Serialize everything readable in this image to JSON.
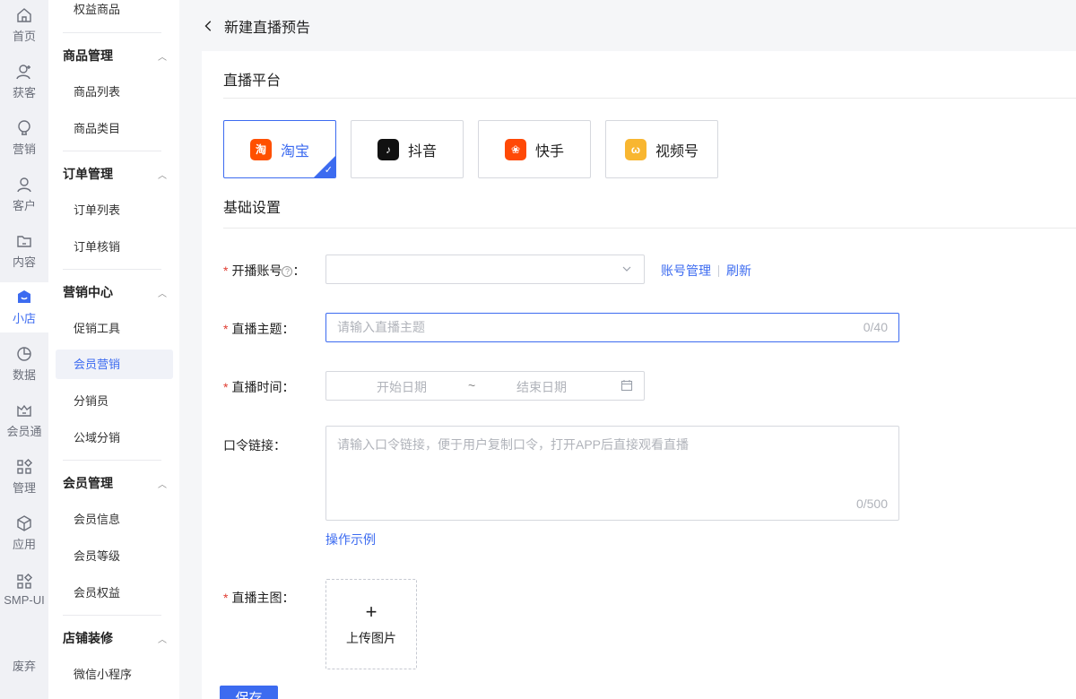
{
  "rail": {
    "items": [
      {
        "label": "首页"
      },
      {
        "label": "获客"
      },
      {
        "label": "营销"
      },
      {
        "label": "客户"
      },
      {
        "label": "内容"
      },
      {
        "label": "小店"
      },
      {
        "label": "数据"
      },
      {
        "label": "会员通"
      },
      {
        "label": "管理"
      },
      {
        "label": "应用"
      },
      {
        "label": "SMP-UI"
      }
    ],
    "bottom_label": "废弃"
  },
  "submenu": {
    "top_item": "权益商品",
    "groups": [
      {
        "title": "商品管理",
        "items": [
          "商品列表",
          "商品类目"
        ]
      },
      {
        "title": "订单管理",
        "items": [
          "订单列表",
          "订单核销"
        ]
      },
      {
        "title": "营销中心",
        "items": [
          "促销工具",
          "会员营销",
          "分销员",
          "公域分销"
        ]
      },
      {
        "title": "会员管理",
        "items": [
          "会员信息",
          "会员等级",
          "会员权益"
        ]
      },
      {
        "title": "店铺装修",
        "items": [
          "微信小程序"
        ]
      }
    ]
  },
  "header": {
    "title": "新建直播预告"
  },
  "platform_section": {
    "title": "直播平台",
    "platforms": [
      {
        "label": "淘宝",
        "icon": "taobao-icon",
        "color": "#ff5000"
      },
      {
        "label": "抖音",
        "icon": "douyin-icon",
        "color": "#111111"
      },
      {
        "label": "快手",
        "icon": "kuaishou-icon",
        "color": "#ff4906"
      },
      {
        "label": "视频号",
        "icon": "channels-icon",
        "color": "#f8b631"
      }
    ]
  },
  "basic_section": {
    "title": "基础设置",
    "account": {
      "label": "开播账号",
      "colon": "：",
      "links": {
        "manage": "账号管理",
        "refresh": "刷新"
      }
    },
    "topic": {
      "label": "直播主题：",
      "placeholder": "请输入直播主题",
      "count": "0/40"
    },
    "time": {
      "label": "直播时间：",
      "start_placeholder": "开始日期",
      "separator": "~",
      "end_placeholder": "结束日期"
    },
    "command_link": {
      "label": "口令链接：",
      "placeholder": "请输入口令链接，便于用户复制口令，打开APP后直接观看直播",
      "count": "0/500",
      "example": "操作示例"
    },
    "main_image": {
      "label": "直播主图：",
      "plus": "+",
      "upload_text": "上传图片"
    }
  },
  "actions": {
    "save": "保存"
  },
  "colors": {
    "accent": "#3c6bf0",
    "required": "#e03c31"
  }
}
